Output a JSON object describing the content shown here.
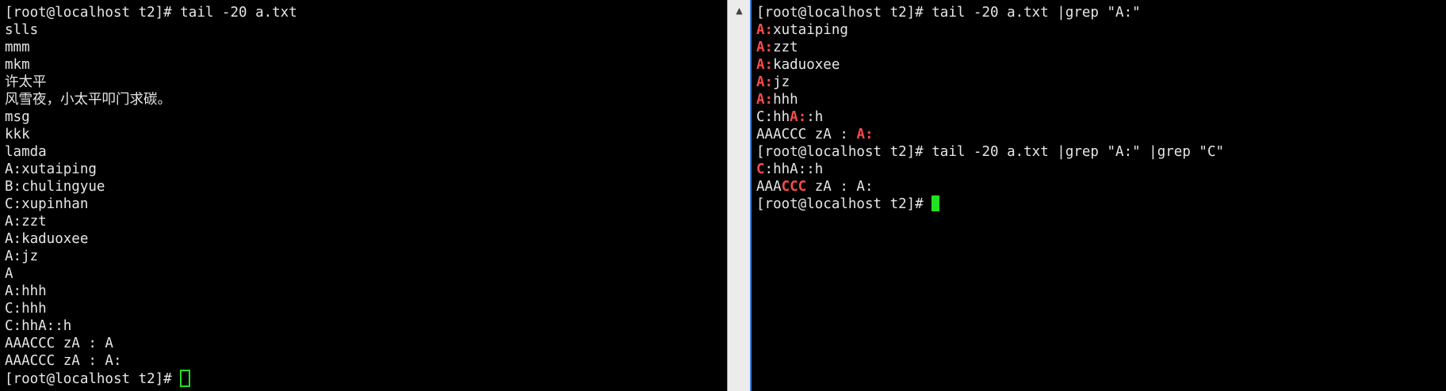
{
  "left_terminal": {
    "lines": [
      "[root@localhost t2]# tail -20 a.txt",
      "slls",
      "mmm",
      "mkm",
      "许太平",
      "风雪夜，小太平叩门求碳。",
      "msg",
      "kkk",
      "lamda",
      "A:xutaiping",
      "B:chulingyue",
      "C:xupinhan",
      "A:zzt",
      "A:kaduoxee",
      "A:jz",
      "A",
      "A:hhh",
      "C:hhh",
      "C:hhA::h",
      "AAACCC zA : A",
      "AAACCC zA : A:"
    ],
    "prompt": "[root@localhost t2]# "
  },
  "right_terminal": {
    "line1": "[root@localhost t2]# tail -20 a.txt |grep \"A:\"",
    "l2": {
      "match": "A:",
      "rest": "xutaiping"
    },
    "l3": {
      "match": "A:",
      "rest": "zzt"
    },
    "l4": {
      "match": "A:",
      "rest": "kaduoxee"
    },
    "l5": {
      "match": "A:",
      "rest": "jz"
    },
    "l6": {
      "match": "A:",
      "rest": "hhh"
    },
    "l7": {
      "pre": "C:hh",
      "match": "A:",
      "post": ":h"
    },
    "l8": {
      "pre": "AAACCC zA : ",
      "match": "A:"
    },
    "line9": "[root@localhost t2]# tail -20 a.txt |grep \"A:\" |grep \"C\"",
    "l10": {
      "match": "C",
      "rest": ":hhA::h"
    },
    "l11": {
      "pre": "AAA",
      "match": "CCC",
      "post": " zA : A:"
    },
    "prompt": "[root@localhost t2]# "
  },
  "scroll": {
    "up_arrow_icon": "triangle-up"
  },
  "colors": {
    "background": "#000000",
    "text": "#e6e6e6",
    "match": "#ff4a4a",
    "cursor": "#22e022",
    "divider": "#ececec",
    "focus_edge": "#3b7bd6"
  }
}
